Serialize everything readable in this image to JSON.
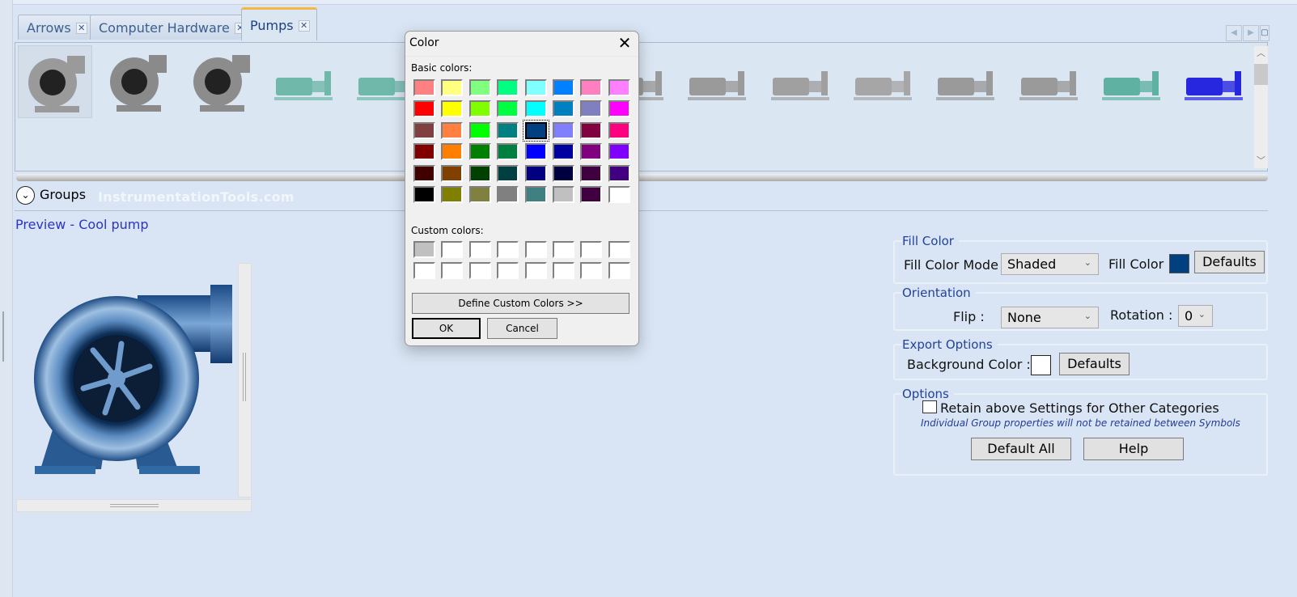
{
  "tabs": [
    {
      "label": "Arrows",
      "active": false
    },
    {
      "label": "Computer Hardware",
      "active": false
    },
    {
      "label": "Pumps",
      "active": true
    }
  ],
  "tab_close": "✕",
  "symbols": {
    "rows": [
      [
        "#9a9a9a",
        "#8a8a8a",
        "#8c8c8c",
        "#6fb8aa",
        "#6fb8aa",
        "#8fb0a8",
        "#9a9a9a",
        "#9a9a9a",
        "#9a9a9a",
        "#a0a0a0",
        "#a6a6a6",
        "#9a9a9a",
        "#9a9a9a",
        "#5fb2a2",
        "#2727e0"
      ],
      [
        "#9a9a9a",
        "#8a8a8a",
        "#9a9a9a",
        "#a0a0a0",
        "#9a9a9a",
        "#9a9a9a",
        "#9a9a9a",
        "#2a2ad0",
        "#5a6f8e",
        "#2b2bd8",
        "#3aa83a",
        "#a8a8a8",
        "#d81818",
        "#a0a0a0",
        "#a0a0a0"
      ]
    ],
    "selected_index": 0
  },
  "groups": {
    "label": "Groups"
  },
  "watermark": "InstrumentationTools.com",
  "preview": {
    "title": "Preview - Cool pump",
    "color": "#004080"
  },
  "color_dialog": {
    "title": "Color",
    "basic_label": "Basic colors:",
    "basic_colors": [
      [
        "#FF8080",
        "#FFFF80",
        "#80FF80",
        "#00FF80",
        "#80FFFF",
        "#0080FF",
        "#FF80C0",
        "#FF80FF"
      ],
      [
        "#FF0000",
        "#FFFF00",
        "#80FF00",
        "#00FF40",
        "#00FFFF",
        "#0080C0",
        "#8080C0",
        "#FF00FF"
      ],
      [
        "#804040",
        "#FF8040",
        "#00FF00",
        "#008080",
        "#004080",
        "#8080FF",
        "#800040",
        "#FF0080"
      ],
      [
        "#800000",
        "#FF8000",
        "#008000",
        "#008040",
        "#0000FF",
        "#0000A0",
        "#800080",
        "#8000FF"
      ],
      [
        "#400000",
        "#804000",
        "#004000",
        "#004040",
        "#000080",
        "#000040",
        "#400040",
        "#400080"
      ],
      [
        "#000000",
        "#808000",
        "#808040",
        "#808080",
        "#408080",
        "#C0C0C0",
        "#400040",
        "#FFFFFF"
      ]
    ],
    "selected": [
      2,
      4
    ],
    "custom_label": "Custom colors:",
    "custom_colors": [
      [
        "#C0C0C0",
        "#FFFFFF",
        "#FFFFFF",
        "#FFFFFF",
        "#FFFFFF",
        "#FFFFFF",
        "#FFFFFF",
        "#FFFFFF"
      ],
      [
        "#FFFFFF",
        "#FFFFFF",
        "#FFFFFF",
        "#FFFFFF",
        "#FFFFFF",
        "#FFFFFF",
        "#FFFFFF",
        "#FFFFFF"
      ]
    ],
    "define_label": "Define Custom Colors >>",
    "ok_label": "OK",
    "cancel_label": "Cancel"
  },
  "fill_color": {
    "group": "Fill Color",
    "mode_label": "Fill Color Mode",
    "mode_value": "Shaded",
    "color_label": "Fill Color",
    "color_value": "#004080",
    "defaults": "Defaults"
  },
  "orientation": {
    "group": "Orientation",
    "flip_label": "Flip :",
    "flip_value": "None",
    "rotation_label": "Rotation :",
    "rotation_value": "0"
  },
  "export": {
    "group": "Export Options",
    "bg_label": "Background Color :",
    "bg_value": "#FFFFFF",
    "defaults": "Defaults"
  },
  "options": {
    "group": "Options",
    "retain_label": "Retain above Settings for Other Categories",
    "retain_checked": false,
    "note": "Individual Group properties will not be retained between Symbols",
    "default_all": "Default All",
    "help": "Help"
  }
}
